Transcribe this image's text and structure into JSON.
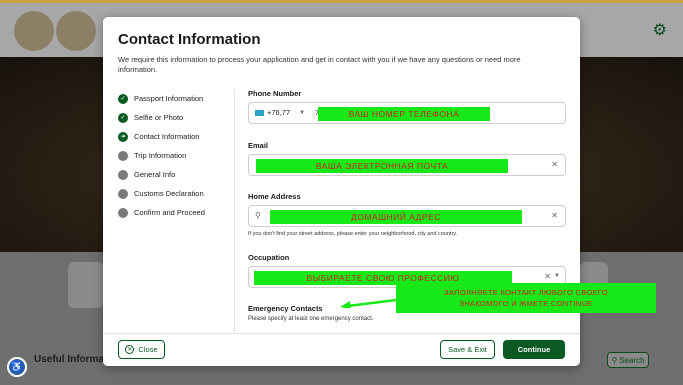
{
  "background": {
    "useful_info": "Useful Informat",
    "search_label": "Search",
    "gear_icon": "gear-icon",
    "search_icon": "search-icon",
    "accessibility_icon": "accessibility-icon"
  },
  "modal": {
    "title": "Contact Information",
    "subtitle": "We require this information to process your application and get in contact with you if we have any questions or need more information."
  },
  "steps": [
    {
      "label": "Passport Information",
      "status": "done"
    },
    {
      "label": "Selfie or Photo",
      "status": "done"
    },
    {
      "label": "Contact Information",
      "status": "active"
    },
    {
      "label": "Trip Information",
      "status": "pending"
    },
    {
      "label": "General Info",
      "status": "pending"
    },
    {
      "label": "Customs Declaration",
      "status": "pending"
    },
    {
      "label": "Confirm and Proceed",
      "status": "pending"
    }
  ],
  "form": {
    "phone": {
      "label": "Phone Number",
      "prefix": "+76,77",
      "value_start": "7",
      "overlay": "ВАШ НОМЕР ТЕЛЕФОНА"
    },
    "email": {
      "label": "Email",
      "overlay": "ВАША ЭЛЕКТРОННАЯ ПОЧТА"
    },
    "address": {
      "label": "Home Address",
      "overlay": "ДОМАШНИЙ АДРЕС",
      "hint": "If you don't find your street address, please enter your neighborhood, city and country."
    },
    "occupation": {
      "label": "Occupation",
      "overlay": "ВЫБИРАЕТЕ СВОЮ ПРОФЕССИЮ"
    },
    "emergency": {
      "label": "Emergency Contacts",
      "hint": "Please specify at least one emergency contact."
    }
  },
  "note": {
    "line1": "ЗАПОЛНЯЕТЕ КОНТАКТ ЛЮБОГО СВОЕГО",
    "line2": "ЗНАКОМОГО И ЖМЕТЕ CONTINUE"
  },
  "footer": {
    "close": "Close",
    "save_exit": "Save & Exit",
    "continue": "Continue"
  },
  "colors": {
    "primary_green": "#0b5a23",
    "overlay_green": "#17e817",
    "overlay_text": "#c62020"
  }
}
